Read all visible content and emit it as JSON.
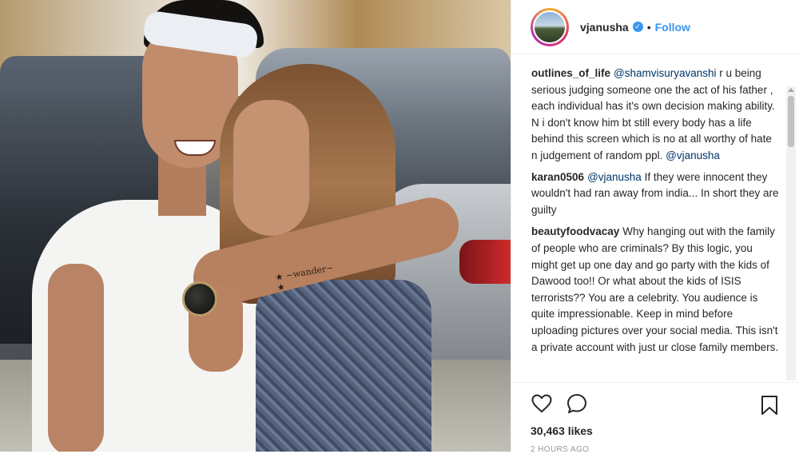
{
  "post": {
    "username": "vjanusha",
    "verified_mark": "✓",
    "separator": "•",
    "follow_label": "Follow"
  },
  "photo": {
    "tattoo_text": "★ ~wander~ ★"
  },
  "comments": [
    {
      "author": "outlines_of_life",
      "mention": "@shamvisuryavanshi",
      "text": " r u being serious judging someone one the act of his father , each individual has it's own decision making ability. N i don't know him bt still every body has a life behind this screen which is no at all worthy of hate n judgement of random ppl. ",
      "mention2": "@vjanusha"
    },
    {
      "author": "karan0506",
      "mention": "@vjanusha",
      "text": " If they were innocent they wouldn't had ran away from india... In short they are guilty"
    },
    {
      "author": "beautyfoodvacay",
      "text": "Why hanging out with the family of people who are criminals? By this logic, you might get up one day and go party with the kids of Dawood too!! Or what about the kids of ISIS terrorists?? You are a celebrity. You audience is quite impressionable. Keep in mind before uploading pictures over your social media. This isn't a private account with just ur close family members."
    }
  ],
  "actions": {
    "like_icon": "heart-icon",
    "comment_icon": "comment-icon",
    "save_icon": "bookmark-icon",
    "likes": "30,463 likes",
    "time": "2 HOURS AGO"
  },
  "colors": {
    "link": "#3897f0",
    "mention": "#003569",
    "text": "#262626"
  }
}
